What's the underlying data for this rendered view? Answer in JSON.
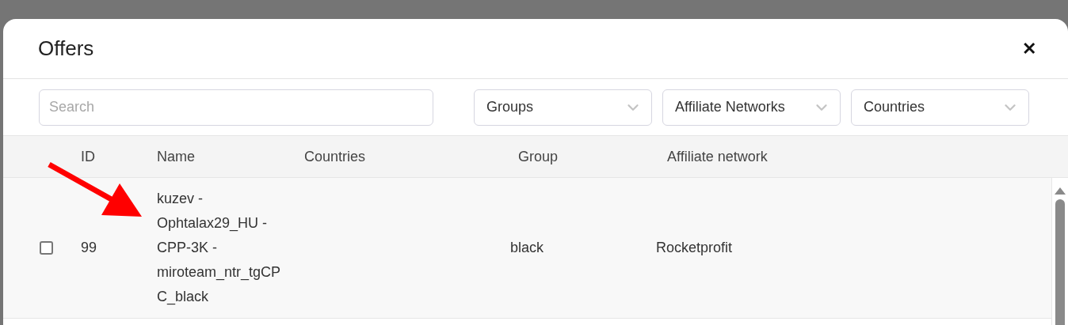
{
  "dialog": {
    "title": "Offers",
    "close": "✕"
  },
  "filters": {
    "search": {
      "placeholder": "Search"
    },
    "selects": [
      {
        "label": "Groups"
      },
      {
        "label": "Affiliate Networks"
      },
      {
        "label": "Countries"
      }
    ]
  },
  "table": {
    "columns": [
      "ID",
      "Name",
      "Countries",
      "Group",
      "Affiliate network"
    ],
    "rows": [
      {
        "checked": false,
        "id": "99",
        "name": "kuzev - Ophtalax29_HU - CPP-3K - miroteam_ntr_tgCPC_black",
        "group": "black",
        "affiliate_network": "Rocketprofit"
      }
    ]
  }
}
